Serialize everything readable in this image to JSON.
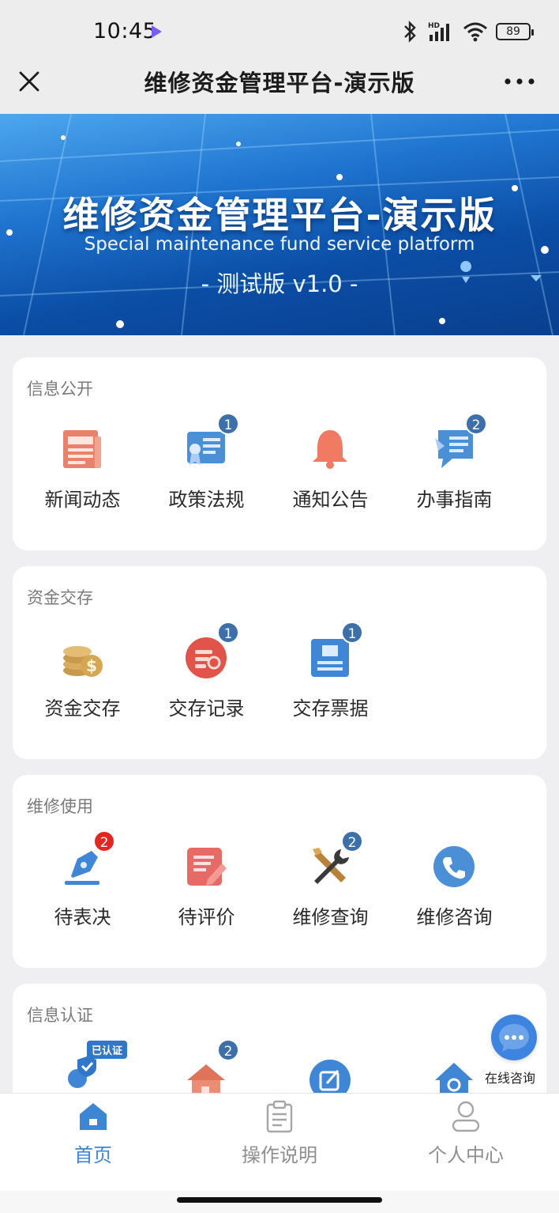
{
  "status": {
    "time": "10:45",
    "battery": "89",
    "network": "HD"
  },
  "header": {
    "title": "维修资金管理平台-演示版"
  },
  "banner": {
    "title": "维修资金管理平台-演示版",
    "subtitle": "Special maintenance fund service platform",
    "version": "- 测试版 v1.0 -"
  },
  "sections": [
    {
      "title": "信息公开",
      "items": [
        {
          "label": "新闻动态",
          "badge": ""
        },
        {
          "label": "政策法规",
          "badge": "1"
        },
        {
          "label": "通知公告",
          "badge": ""
        },
        {
          "label": "办事指南",
          "badge": "2"
        }
      ]
    },
    {
      "title": "资金交存",
      "items": [
        {
          "label": "资金交存",
          "badge": ""
        },
        {
          "label": "交存记录",
          "badge": "1"
        },
        {
          "label": "交存票据",
          "badge": "1"
        }
      ]
    },
    {
      "title": "维修使用",
      "items": [
        {
          "label": "待表决",
          "badge": "2"
        },
        {
          "label": "待评价",
          "badge": ""
        },
        {
          "label": "维修查询",
          "badge": "2"
        },
        {
          "label": "维修咨询",
          "badge": ""
        }
      ]
    },
    {
      "title": "信息认证",
      "items": [
        {
          "label": "",
          "badge": "",
          "tag": "已认证"
        },
        {
          "label": "",
          "badge": "2"
        },
        {
          "label": "",
          "badge": ""
        },
        {
          "label": "",
          "badge": ""
        }
      ]
    }
  ],
  "float": {
    "label": "在线咨询"
  },
  "tabbar": [
    {
      "label": "首页",
      "active": true
    },
    {
      "label": "操作说明",
      "active": false
    },
    {
      "label": "个人中心",
      "active": false
    }
  ],
  "colors": {
    "accent": "#3d86d6",
    "badge": "#3d6fa9",
    "badge_alert": "#e32620",
    "inactive": "#9a9a9a"
  }
}
